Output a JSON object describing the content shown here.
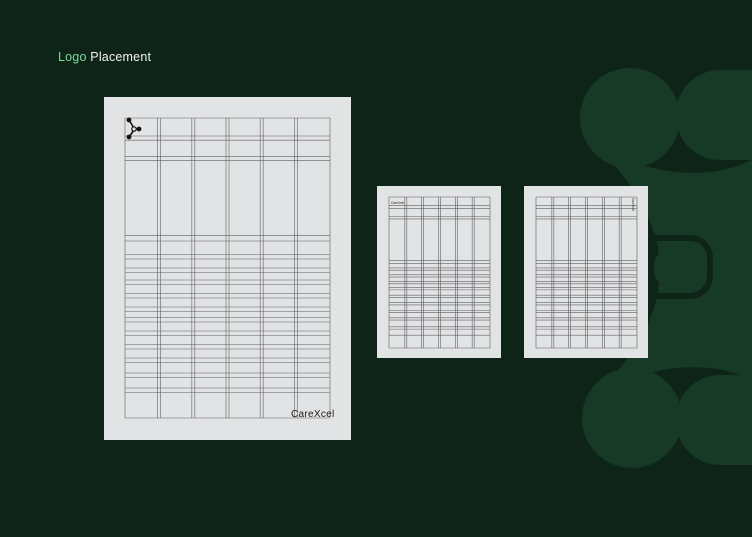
{
  "heading": {
    "part1": "Logo",
    "part2": " Placement"
  },
  "brand": {
    "wordmark": "CareXcel"
  },
  "colors": {
    "background": "#0f2418",
    "watermark": "#163a26",
    "accent_green": "#7fd99a",
    "sheet": "#e2e3e4",
    "grid_line": "#5f6062"
  },
  "icons": {
    "logo_mark": "molecule-logo-icon"
  }
}
